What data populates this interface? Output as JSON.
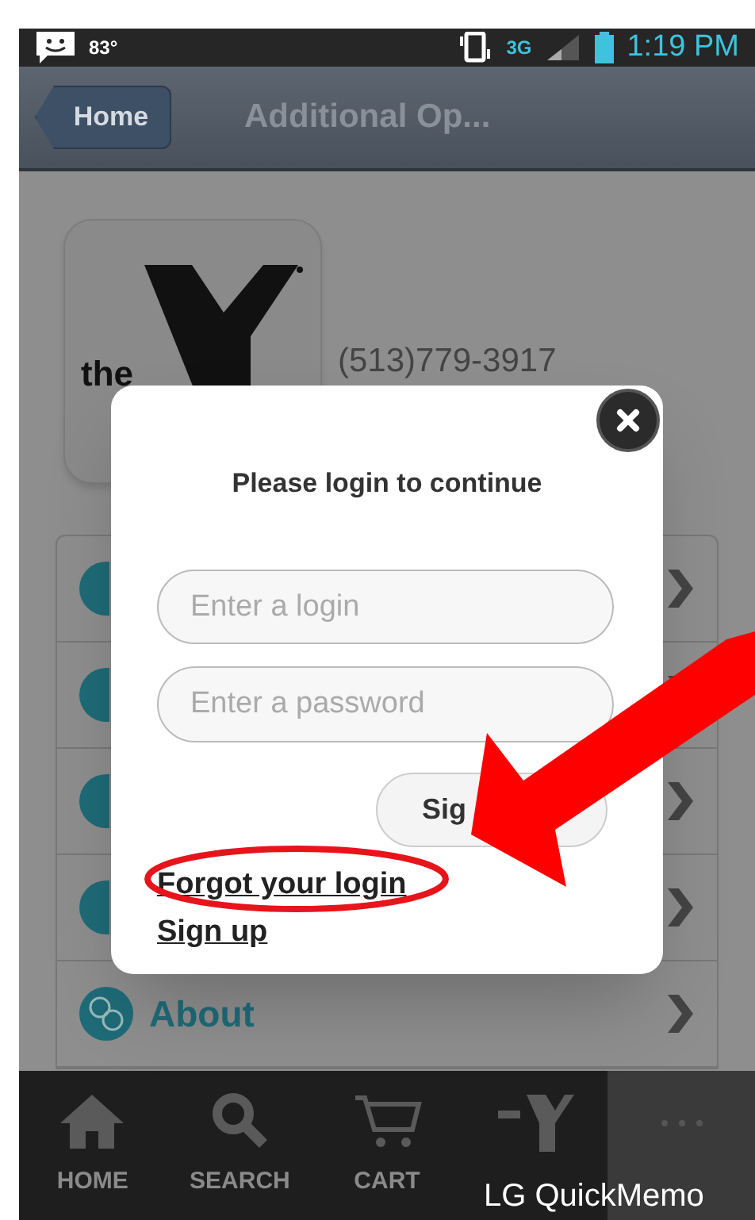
{
  "status_bar": {
    "temperature": "83°",
    "network": "3G",
    "time": "1:19 PM"
  },
  "nav_bar": {
    "back_button": "Home",
    "title": "Additional Op..."
  },
  "contact": {
    "logo_text": "the",
    "phone": "(513)779-3917"
  },
  "menu": [
    {
      "label": "About"
    }
  ],
  "login_dialog": {
    "title": "Please login to continue",
    "login_placeholder": "Enter a login",
    "password_placeholder": "Enter a password",
    "submit_button": "Sig",
    "links": [
      "Forgot your login",
      "Sign up"
    ]
  },
  "tab_bar": [
    {
      "label": "HOME",
      "selected": false
    },
    {
      "label": "SEARCH",
      "selected": false
    },
    {
      "label": "CART",
      "selected": false
    },
    {
      "selected": false
    },
    {
      "selected": true
    }
  ],
  "overlay_text": "LG QuickMemo"
}
